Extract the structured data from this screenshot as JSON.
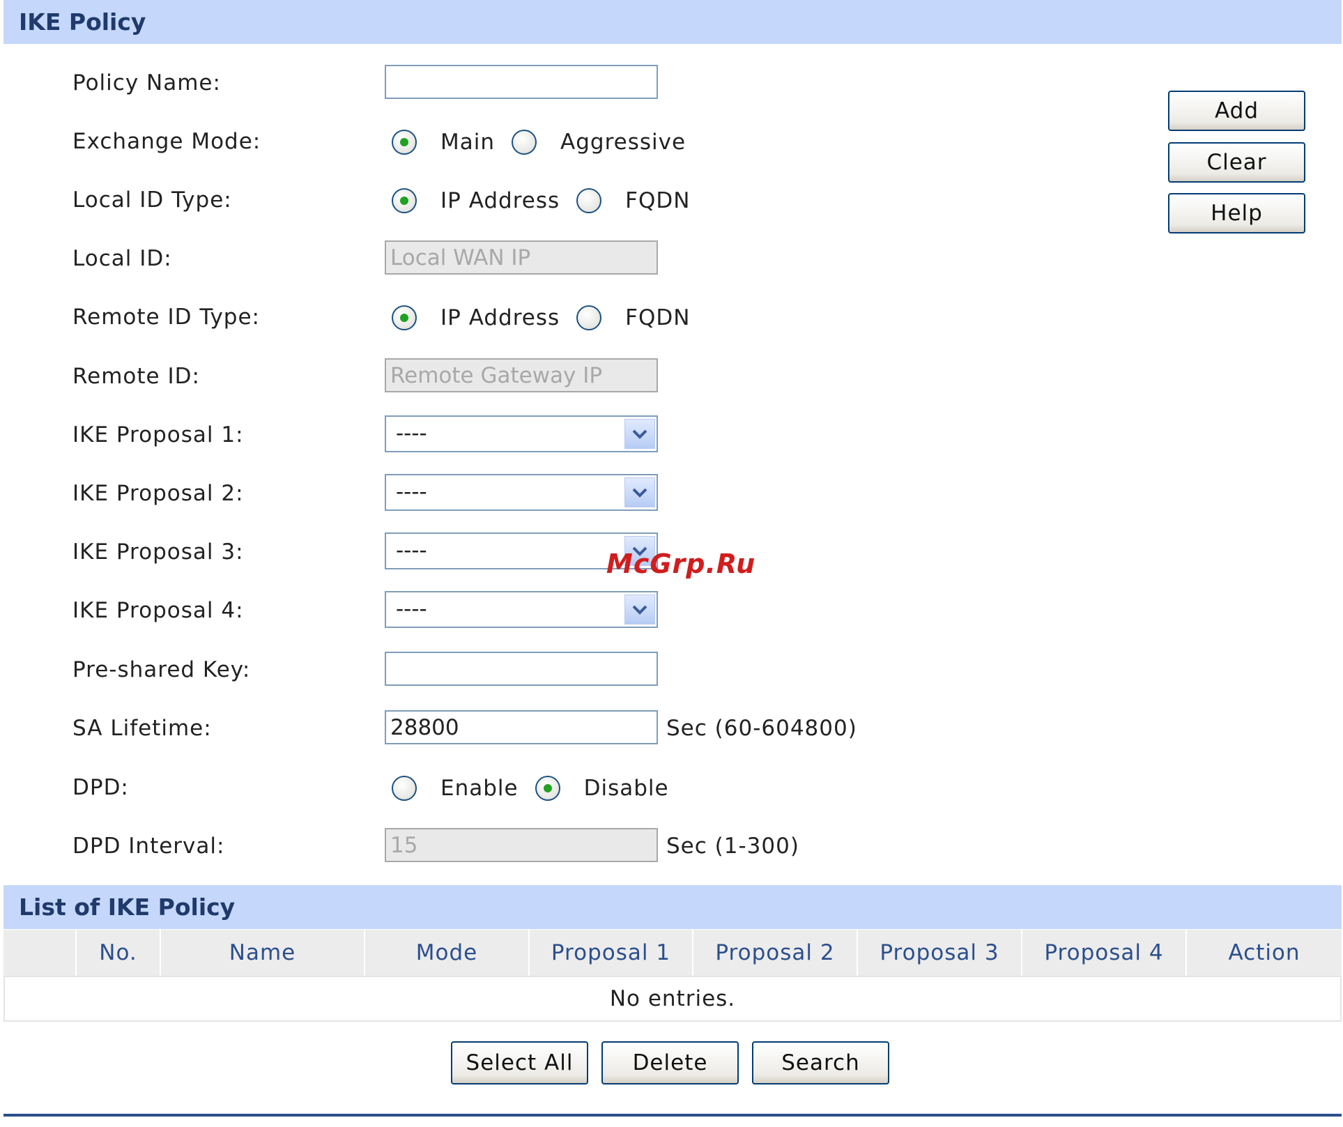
{
  "ike_policy": {
    "header": "IKE Policy",
    "labels": {
      "policy_name": "Policy Name:",
      "exchange_mode": "Exchange Mode:",
      "local_id_type": "Local ID Type:",
      "local_id": "Local ID:",
      "remote_id_type": "Remote ID Type:",
      "remote_id": "Remote ID:",
      "proposal1": "IKE Proposal 1:",
      "proposal2": "IKE Proposal 2:",
      "proposal3": "IKE Proposal 3:",
      "proposal4": "IKE Proposal 4:",
      "psk": "Pre-shared Key:",
      "sa_lifetime": "SA Lifetime:",
      "dpd": "DPD:",
      "dpd_interval": "DPD Interval:"
    },
    "policy_name_value": "",
    "exchange_mode": {
      "options": [
        "Main",
        "Aggressive"
      ],
      "selected": "Main"
    },
    "local_id_type": {
      "options": [
        "IP Address",
        "FQDN"
      ],
      "selected": "IP Address"
    },
    "local_id_placeholder": "Local WAN IP",
    "remote_id_type": {
      "options": [
        "IP Address",
        "FQDN"
      ],
      "selected": "IP Address"
    },
    "remote_id_placeholder": "Remote Gateway IP",
    "proposals": [
      "----",
      "----",
      "----",
      "----"
    ],
    "psk_value": "",
    "sa_lifetime_value": "28800",
    "sa_lifetime_hint": "Sec (60-604800)",
    "dpd": {
      "options": [
        "Enable",
        "Disable"
      ],
      "selected": "Disable"
    },
    "dpd_interval_value": "15",
    "dpd_interval_hint": "Sec (1-300)"
  },
  "actions": {
    "add": "Add",
    "clear": "Clear",
    "help": "Help"
  },
  "list": {
    "header": "List of IKE Policy",
    "columns": [
      "",
      "No.",
      "Name",
      "Mode",
      "Proposal 1",
      "Proposal 2",
      "Proposal 3",
      "Proposal 4",
      "Action"
    ],
    "empty_text": "No entries."
  },
  "list_actions": {
    "select_all": "Select All",
    "delete": "Delete",
    "search": "Search"
  },
  "watermark": "McGrp.Ru",
  "colors": {
    "header_bg": "#c5d8fb",
    "header_text": "#1f3a6b",
    "accent": "#2b4f8c",
    "radio_dot": "#21a121"
  }
}
